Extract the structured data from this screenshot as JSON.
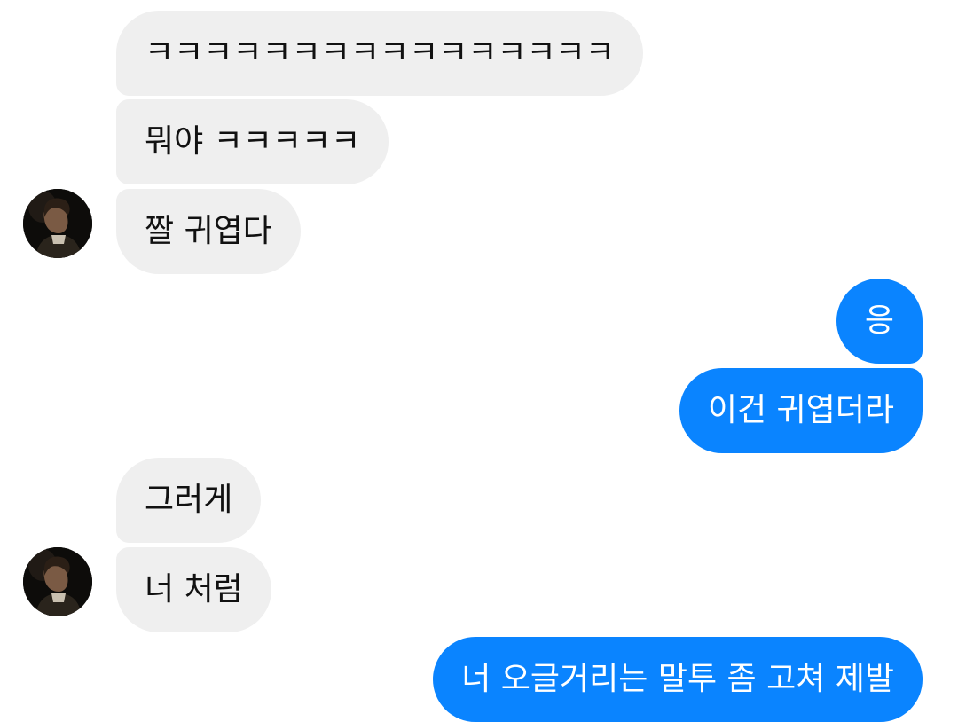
{
  "conversation": {
    "messages": [
      {
        "sender": "other",
        "text": "ㅋㅋㅋㅋㅋㅋㅋㅋㅋㅋㅋㅋㅋㅋㅋㅋ"
      },
      {
        "sender": "other",
        "text": "뭐야 ㅋㅋㅋㅋㅋ"
      },
      {
        "sender": "other",
        "text": "짤 귀엽다"
      },
      {
        "sender": "me",
        "text": "응"
      },
      {
        "sender": "me",
        "text": "이건 귀엽더라"
      },
      {
        "sender": "other",
        "text": "그러게"
      },
      {
        "sender": "other",
        "text": "너 처럼"
      },
      {
        "sender": "me",
        "text": "너 오글거리는 말투 좀 고쳐 제발"
      }
    ]
  },
  "avatar": {
    "icon": "contact-profile-photo"
  },
  "colors": {
    "outgoing_bubble": "#0a84ff",
    "incoming_bubble": "#efefef",
    "incoming_text": "#111111",
    "outgoing_text": "#ffffff"
  }
}
